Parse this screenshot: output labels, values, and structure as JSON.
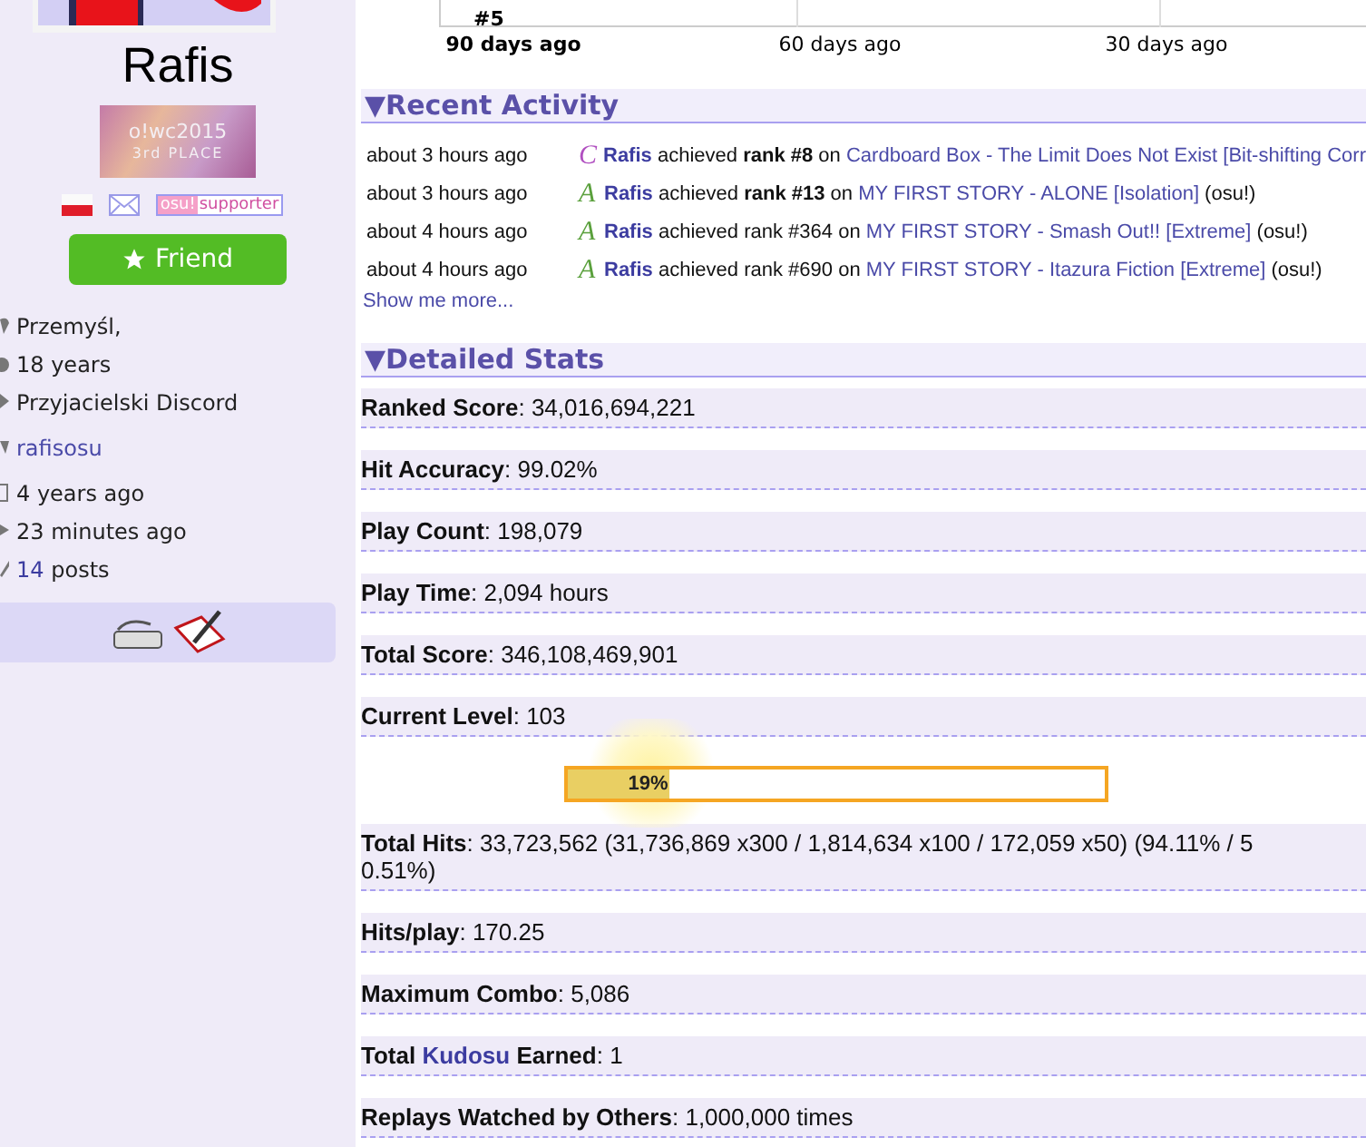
{
  "profile": {
    "name": "Rafis",
    "badge": {
      "title": "o!wc2015",
      "subtitle": "3rd PLACE"
    },
    "supporter_tag": {
      "left": "osu!",
      "right": "supporter"
    },
    "friend_button": "Friend",
    "info": [
      {
        "kind": "location",
        "text": "Przemyśl,",
        "link": false
      },
      {
        "kind": "age",
        "text": "18 years",
        "link": false
      },
      {
        "kind": "group",
        "text": "Przyjacielski Discord",
        "link": false
      },
      {
        "kind": "contact",
        "text": "rafisosu",
        "link": true
      },
      {
        "kind": "joined",
        "text": "4 years ago",
        "link": false
      },
      {
        "kind": "seen",
        "text": "23 minutes ago",
        "link": false
      },
      {
        "kind": "posts",
        "count": "14",
        "text": "posts",
        "link": true
      }
    ]
  },
  "chart": {
    "rank_label": "#5",
    "x_labels": [
      {
        "text": "90 days ago",
        "bold": true
      },
      {
        "text": "60 days ago",
        "bold": false
      },
      {
        "text": "30 days ago",
        "bold": false
      }
    ]
  },
  "recent_activity": {
    "marker": "▼",
    "title": "Recent Activity",
    "items": [
      {
        "time": "about 3 hours ago",
        "grade": "C",
        "color": "#b04fc0",
        "user": "Rafis",
        "verb": "achieved",
        "rank": "rank #8",
        "rank_bold": true,
        "on": "on",
        "beatmap": "Cardboard Box - The Limit Does Not Exist [Bit-shifting Corr"
      },
      {
        "time": "about 3 hours ago",
        "grade": "A",
        "color": "#5aa03c",
        "user": "Rafis",
        "verb": "achieved",
        "rank": "rank #13",
        "rank_bold": true,
        "on": "on",
        "beatmap": "MY FIRST STORY - ALONE [Isolation]",
        "mode": "(osu!)"
      },
      {
        "time": "about 4 hours ago",
        "grade": "A",
        "color": "#5aa03c",
        "user": "Rafis",
        "verb": "achieved",
        "rank": "rank #364",
        "rank_bold": false,
        "on": "on",
        "beatmap": "MY FIRST STORY - Smash Out!! [Extreme]",
        "mode": "(osu!)"
      },
      {
        "time": "about 4 hours ago",
        "grade": "A",
        "color": "#5aa03c",
        "user": "Rafis",
        "verb": "achieved",
        "rank": "rank #690",
        "rank_bold": false,
        "on": "on",
        "beatmap": "MY FIRST STORY - Itazura Fiction [Extreme]",
        "mode": "(osu!)"
      }
    ],
    "more_link": "Show me more..."
  },
  "detailed_stats": {
    "marker": "▼",
    "title": "Detailed Stats",
    "separator": ":",
    "rows": [
      {
        "kind": "plain",
        "label": "Ranked Score",
        "value": "34,016,694,221"
      },
      {
        "kind": "plain",
        "label": "Hit Accuracy",
        "value": "99.02%"
      },
      {
        "kind": "plain",
        "label": "Play Count",
        "value": "198,079"
      },
      {
        "kind": "plain",
        "label": "Play Time",
        "value": "2,094 hours"
      },
      {
        "kind": "plain",
        "label": "Total Score",
        "value": "346,108,469,901"
      },
      {
        "kind": "level",
        "label": "Current Level",
        "value": "103",
        "level": 0.19,
        "reading": "19%"
      },
      {
        "kind": "wrapped",
        "label": "Total Hits",
        "value": "33,723,562 (31,736,869 x300 / 1,814,634 x100 / 172,059 x50) (94.11% / 5",
        "continuation": "0.51%)"
      },
      {
        "kind": "plain",
        "label": "Hits/play",
        "value": "170.25"
      },
      {
        "kind": "plain",
        "label": "Maximum Combo",
        "value": "5,086"
      },
      {
        "kind": "linked",
        "label_before": "Total",
        "label_link": "Kudosu",
        "label_after": "Earned",
        "value": "1"
      },
      {
        "kind": "plain",
        "label": "Replays Watched by Others",
        "value": "1,000,000 times"
      }
    ]
  }
}
